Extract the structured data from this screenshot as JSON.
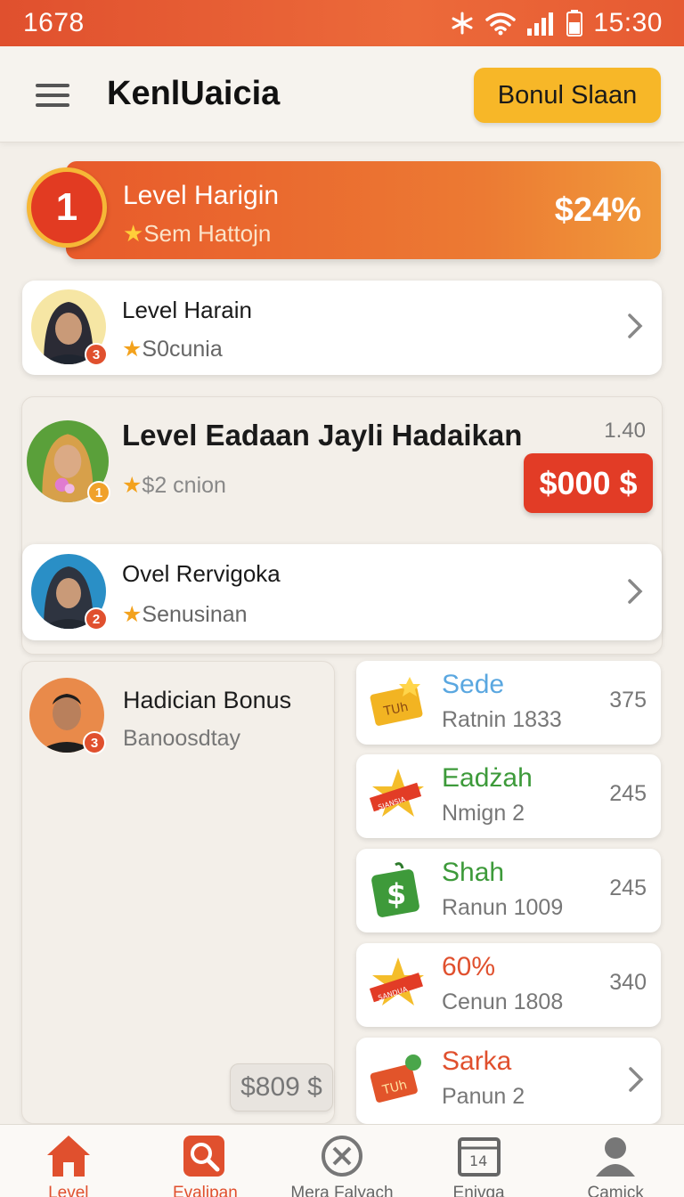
{
  "status_bar": {
    "left_text": "1678",
    "time": "15:30"
  },
  "app_bar": {
    "title": "KenlUaicia",
    "bonus_button": "Bonul Slaan"
  },
  "level_banner": {
    "rank": "1",
    "title": "Level Harigin",
    "subtitle": "Sem Hattojn",
    "value": "$24%"
  },
  "cards": [
    {
      "title": "Level Harain",
      "subtitle": "S0cunia",
      "rank": "3"
    },
    {
      "title": "Level Eadaan Jayli Hadaikan",
      "subtitle": "$2 cnion",
      "rank": "1",
      "corner": "1.40",
      "price": "$000 $"
    },
    {
      "title": "Ovel Rervigoka",
      "subtitle": "Senusinan",
      "rank": "2"
    }
  ],
  "left_panel": {
    "title": "Hadician Bonus",
    "subtitle": "Banoosdtay",
    "rank": "3",
    "price": "$809 $"
  },
  "rewards": [
    {
      "name": "Sede",
      "sub": "Ratnin 1833",
      "value": "375",
      "color": "#5aa7e0",
      "icon": "ticket-icon",
      "icon_text": "TUh"
    },
    {
      "name": "Eadżah",
      "sub": "Nmign 2",
      "value": "245",
      "color": "#3d9a3a",
      "icon": "ribbon-star-icon",
      "icon_text": "SIANSIA"
    },
    {
      "name": "Shah",
      "sub": "Ranun 1009",
      "value": "245",
      "color": "#3d9a3a",
      "icon": "money-bag-icon",
      "icon_text": "$"
    },
    {
      "name": "60%",
      "sub": "Cenun 1808",
      "value": "340",
      "color": "#e0502e",
      "icon": "ribbon-star-icon",
      "icon_text": "SANDUA"
    },
    {
      "name": "Sarka",
      "sub": "Panun 2",
      "value": "",
      "color": "#e0502e",
      "icon": "gift-ticket-icon",
      "icon_text": "TUh"
    }
  ],
  "bottom_nav": [
    {
      "label": "Level",
      "icon": "home-icon",
      "active": true
    },
    {
      "label": "Evalipan",
      "icon": "search-icon",
      "active": true
    },
    {
      "label": "Mera Falyach",
      "icon": "close-circle-icon",
      "active": false
    },
    {
      "label": "Enivga",
      "icon": "calendar-icon",
      "active": false,
      "icon_text": "14"
    },
    {
      "label": "Camick",
      "icon": "person-icon",
      "active": false
    }
  ],
  "colors": {
    "accent": "#e0502e",
    "bonus": "#f7b728",
    "price": "#e23c26"
  }
}
